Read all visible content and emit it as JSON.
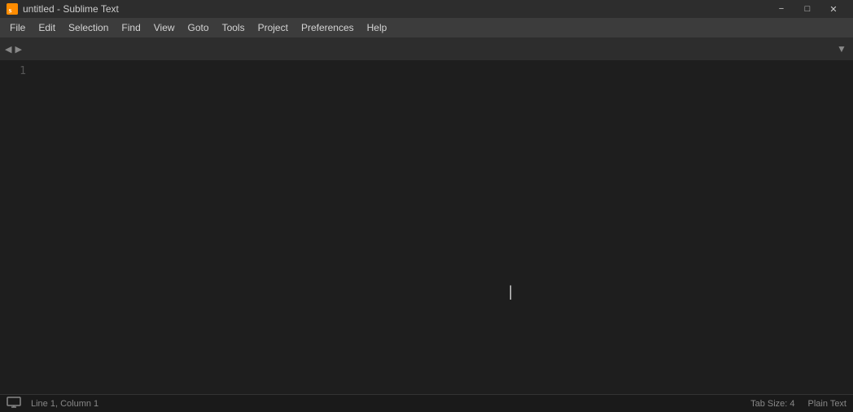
{
  "titlebar": {
    "title": "untitled - Sublime Text",
    "icon": "sublime-text-icon"
  },
  "window_controls": {
    "minimize": "−",
    "maximize": "□",
    "close": "✕"
  },
  "menubar": {
    "items": [
      {
        "label": "File",
        "id": "file"
      },
      {
        "label": "Edit",
        "id": "edit"
      },
      {
        "label": "Selection",
        "id": "selection"
      },
      {
        "label": "Find",
        "id": "find"
      },
      {
        "label": "View",
        "id": "view"
      },
      {
        "label": "Goto",
        "id": "goto"
      },
      {
        "label": "Tools",
        "id": "tools"
      },
      {
        "label": "Project",
        "id": "project"
      },
      {
        "label": "Preferences",
        "id": "preferences"
      },
      {
        "label": "Help",
        "id": "help"
      }
    ]
  },
  "tabbar": {
    "left_arrow": "◀",
    "right_arrow": "▶",
    "dropdown_arrow": "▼"
  },
  "editor": {
    "line_numbers": [
      "1"
    ]
  },
  "statusbar": {
    "left": {
      "monitor_icon": "monitor-icon",
      "position": "Line 1, Column 1"
    },
    "right": {
      "tab_size": "Tab Size: 4",
      "syntax": "Plain Text"
    }
  }
}
